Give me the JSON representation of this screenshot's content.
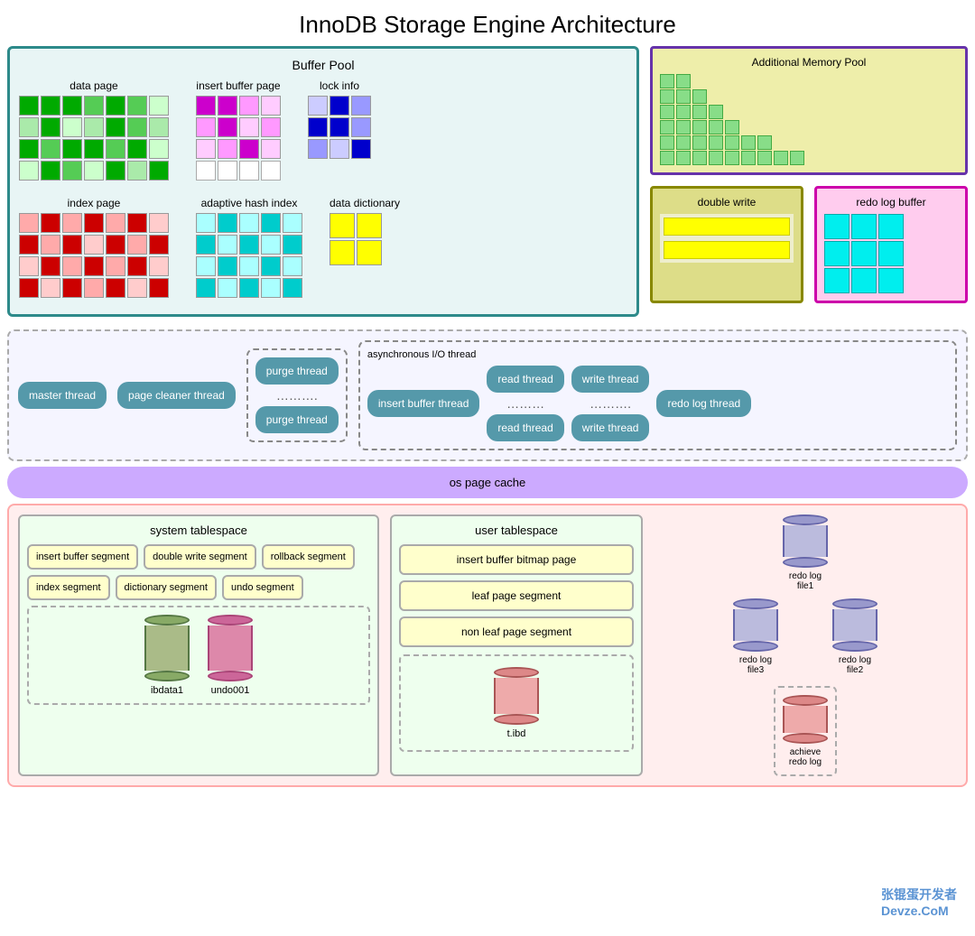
{
  "title": "InnoDB Storage Engine Architecture",
  "bufferPool": {
    "label": "Buffer Pool",
    "dataPage": "data page",
    "insertBufferPage": "insert buffer page",
    "lockInfo": "lock info",
    "indexPage": "index page",
    "adaptiveHashIndex": "adaptive hash index",
    "dataDictionary": "data dictionary"
  },
  "additionalMemPool": {
    "label": "Additional Memory Pool"
  },
  "doubleWrite": {
    "label": "double write"
  },
  "redoLogBuffer": {
    "label": "redo log buffer"
  },
  "threads": {
    "masterThread": "master thread",
    "pageCleanerThread": "page cleaner thread",
    "purgeThread1": "purge thread",
    "purgeDots": "……….",
    "purgeThread2": "purge thread",
    "asyncIOThread": "asynchronous I/O thread",
    "insertBufferThread": "insert buffer thread",
    "readThread": "read thread",
    "readDots": "………",
    "readThread2": "read thread",
    "writeThread": "write thread",
    "writeDots": "……….",
    "writeThread2": "write thread",
    "redoLogThread": "redo log thread"
  },
  "osPageCache": "os page cache",
  "systemTablespace": {
    "label": "system tablespace",
    "insertBufferSegment": "insert buffer segment",
    "doubleWriteSegment": "double write segment",
    "rollbackSegment": "rollback segment",
    "indexSegment": "index segment",
    "dictionarySegment": "dictionary segment",
    "undoSegment": "undo segment",
    "ibdata1": "ibdata1",
    "undo001": "undo001"
  },
  "userTablespace": {
    "label": "user tablespace",
    "insertBufferBitmapPage": "insert buffer bitmap page",
    "leafPageSegment": "leaf page segment",
    "nonLeafPageSegment": "non leaf page segment",
    "tibd": "t.ibd"
  },
  "redoLog": {
    "file1": "redo log\nfile1",
    "file2": "redo log\nfile2",
    "file3": "redo log\nfile3",
    "achieve": "achieve\nredo log"
  },
  "watermark": "张锟蛋开发者\nDevze.CoM"
}
